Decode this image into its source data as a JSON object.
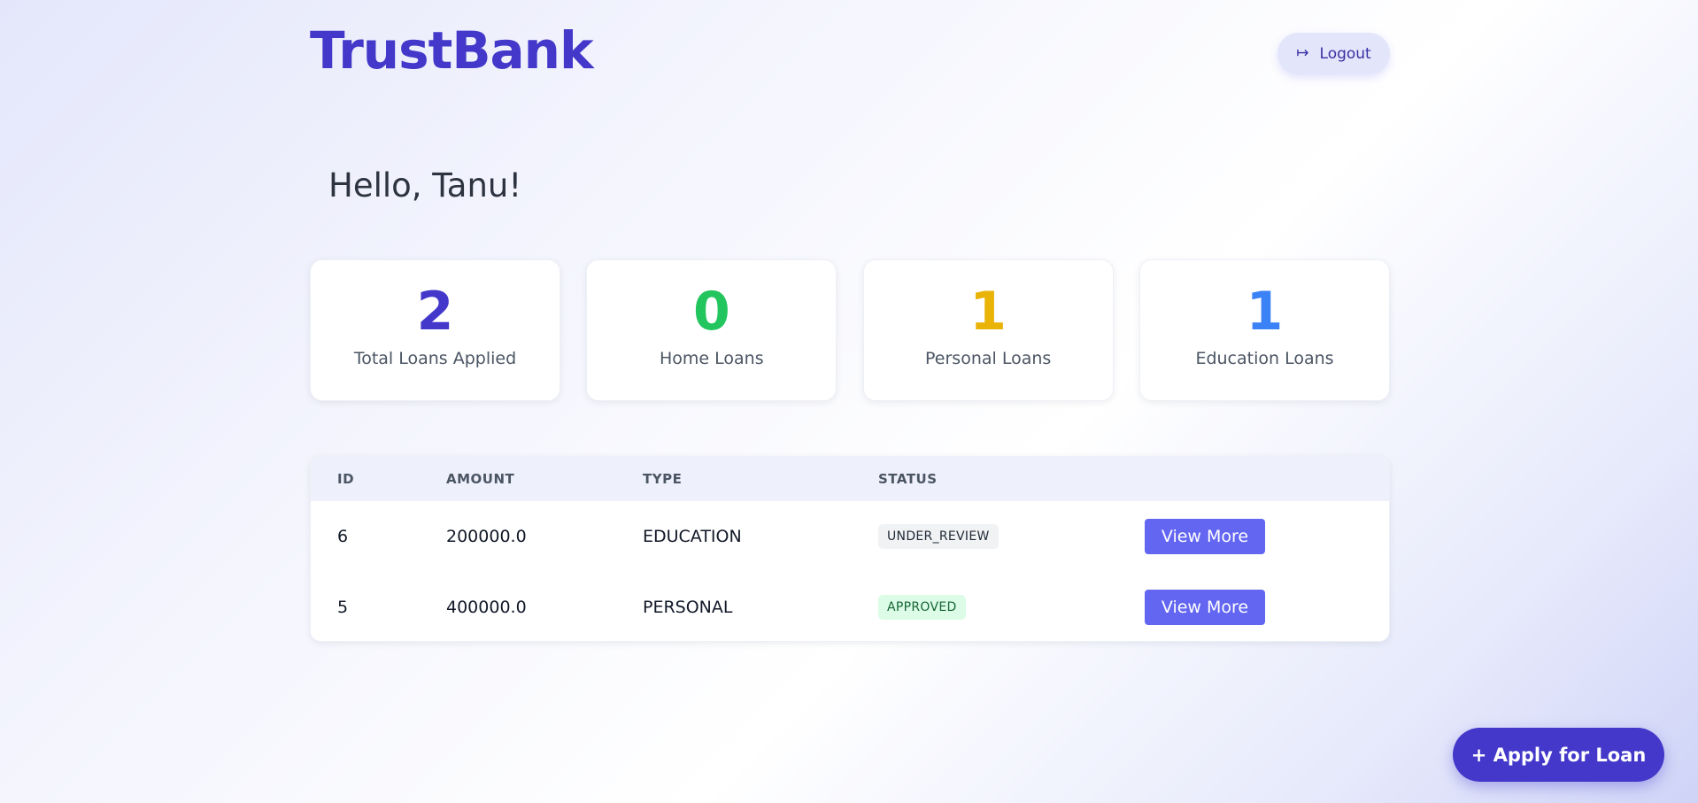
{
  "brand": {
    "name": "TrustBank",
    "color": "#4338ca"
  },
  "header": {
    "logout_label": "Logout",
    "logout_icon": "logout-arrow-icon"
  },
  "greeting": "Hello, Tanu!",
  "stats": [
    {
      "value": "2",
      "label": "Total Loans Applied",
      "color": "#4338ca"
    },
    {
      "value": "0",
      "label": "Home Loans",
      "color": "#22c55e"
    },
    {
      "value": "1",
      "label": "Personal Loans",
      "color": "#eab308"
    },
    {
      "value": "1",
      "label": "Education Loans",
      "color": "#3b82f6"
    }
  ],
  "table": {
    "columns": [
      "ID",
      "AMOUNT",
      "TYPE",
      "STATUS",
      ""
    ],
    "rows": [
      {
        "id": "6",
        "amount": "200000.0",
        "type": "EDUCATION",
        "status": "UNDER_REVIEW",
        "status_bg": "#f1f2f4",
        "status_color": "#1f2937",
        "action_label": "View More"
      },
      {
        "id": "5",
        "amount": "400000.0",
        "type": "PERSONAL",
        "status": "APPROVED",
        "status_bg": "#dcfce7",
        "status_color": "#166534",
        "action_label": "View More"
      }
    ]
  },
  "apply_button_label": "+ Apply for Loan"
}
